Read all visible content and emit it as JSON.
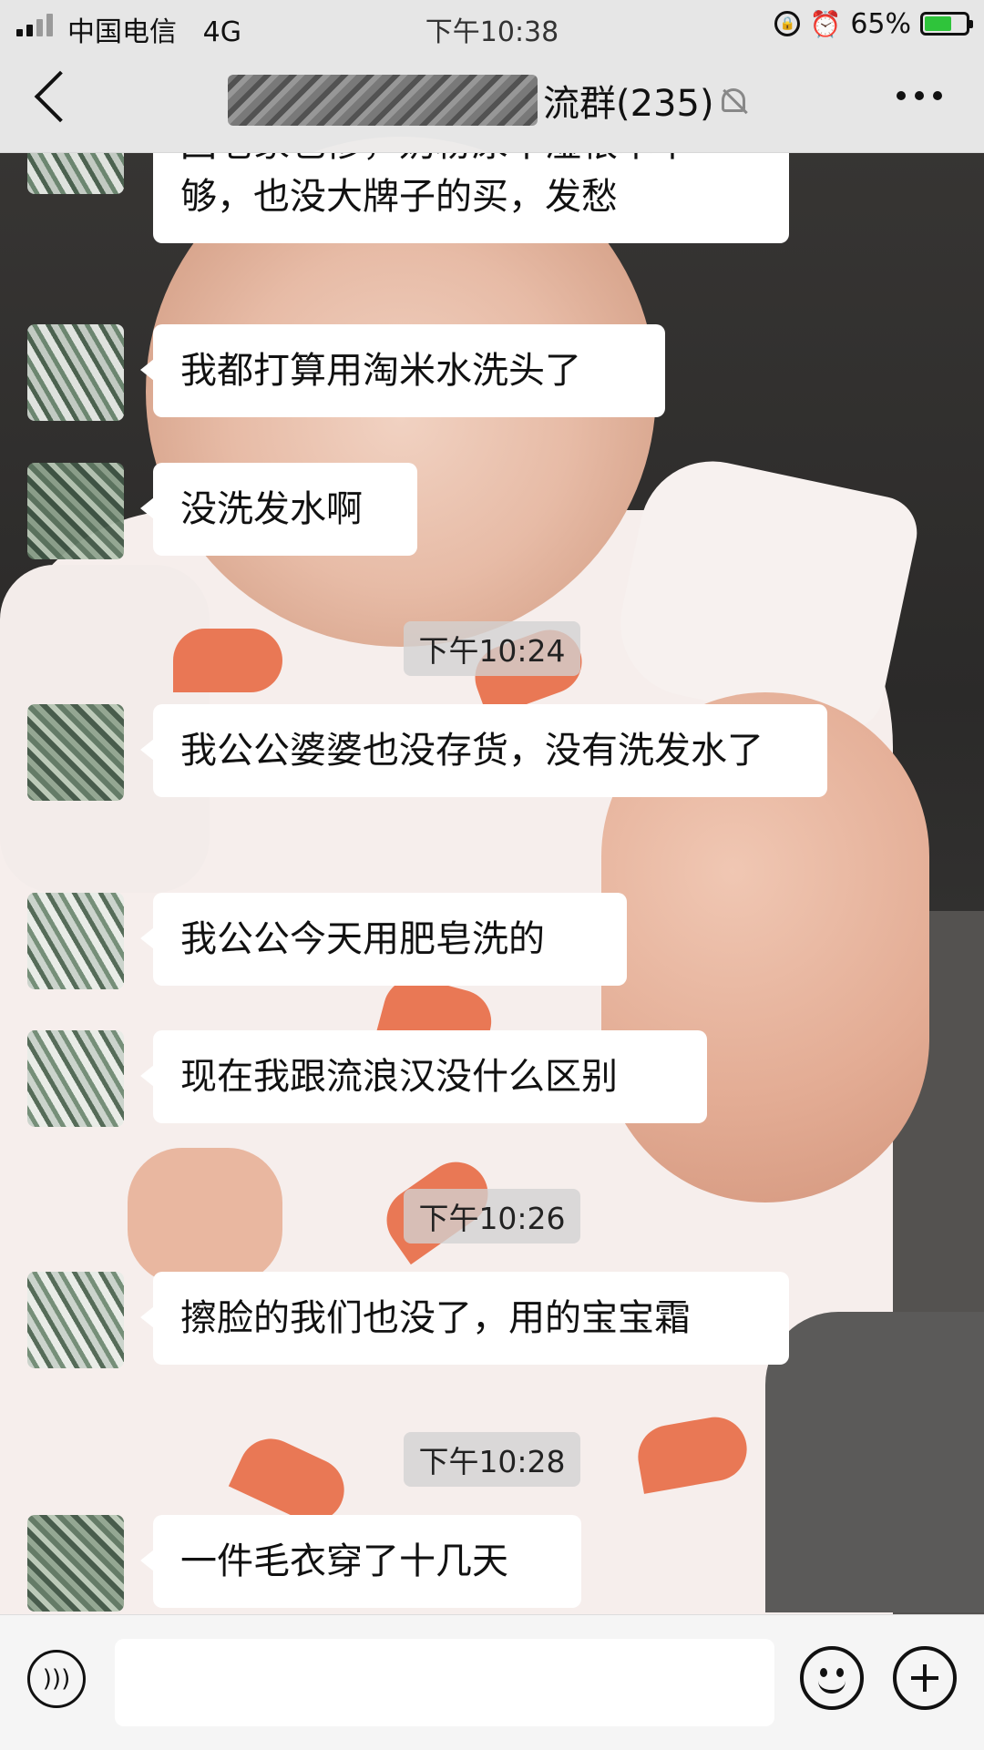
{
  "status_bar": {
    "carrier": "中国电信",
    "network": "4G",
    "time": "下午10:38",
    "battery_percent": "65%",
    "battery_level": 0.65,
    "icons": [
      "signal-icon",
      "orientation-lock-icon",
      "alarm-icon",
      "battery-charging-icon"
    ]
  },
  "header": {
    "title_visible": "流群(235)",
    "icons": {
      "back": "back-chevron-icon",
      "mute": "mute-bell-icon",
      "more": "more-dots-icon"
    }
  },
  "messages": [
    {
      "type": "text",
      "text": "回老家也惨，奶粉尿不湿根本不够，也没大牌子的买，发愁"
    },
    {
      "type": "text",
      "text": "我都打算用淘米水洗头了"
    },
    {
      "type": "text",
      "text": "没洗发水啊"
    },
    {
      "type": "time",
      "text": "下午10:24"
    },
    {
      "type": "text",
      "text": "我公公婆婆也没存货，没有洗发水了"
    },
    {
      "type": "text",
      "text": "我公公今天用肥皂洗的"
    },
    {
      "type": "text",
      "text": "现在我跟流浪汉没什么区别"
    },
    {
      "type": "time",
      "text": "下午10:26"
    },
    {
      "type": "text",
      "text": "擦脸的我们也没了，用的宝宝霜"
    },
    {
      "type": "time",
      "text": "下午10:28"
    },
    {
      "type": "text",
      "text": "一件毛衣穿了十几天"
    }
  ],
  "input_bar": {
    "value": "",
    "icons": {
      "voice": "voice-icon",
      "emoji": "emoji-icon",
      "more": "plus-icon"
    }
  },
  "colors": {
    "bubble_bg": "#ffffff",
    "bar_bg": "#ededed",
    "battery_fill": "#2fc43b",
    "timestamp_bg": "#d2d2d2"
  }
}
